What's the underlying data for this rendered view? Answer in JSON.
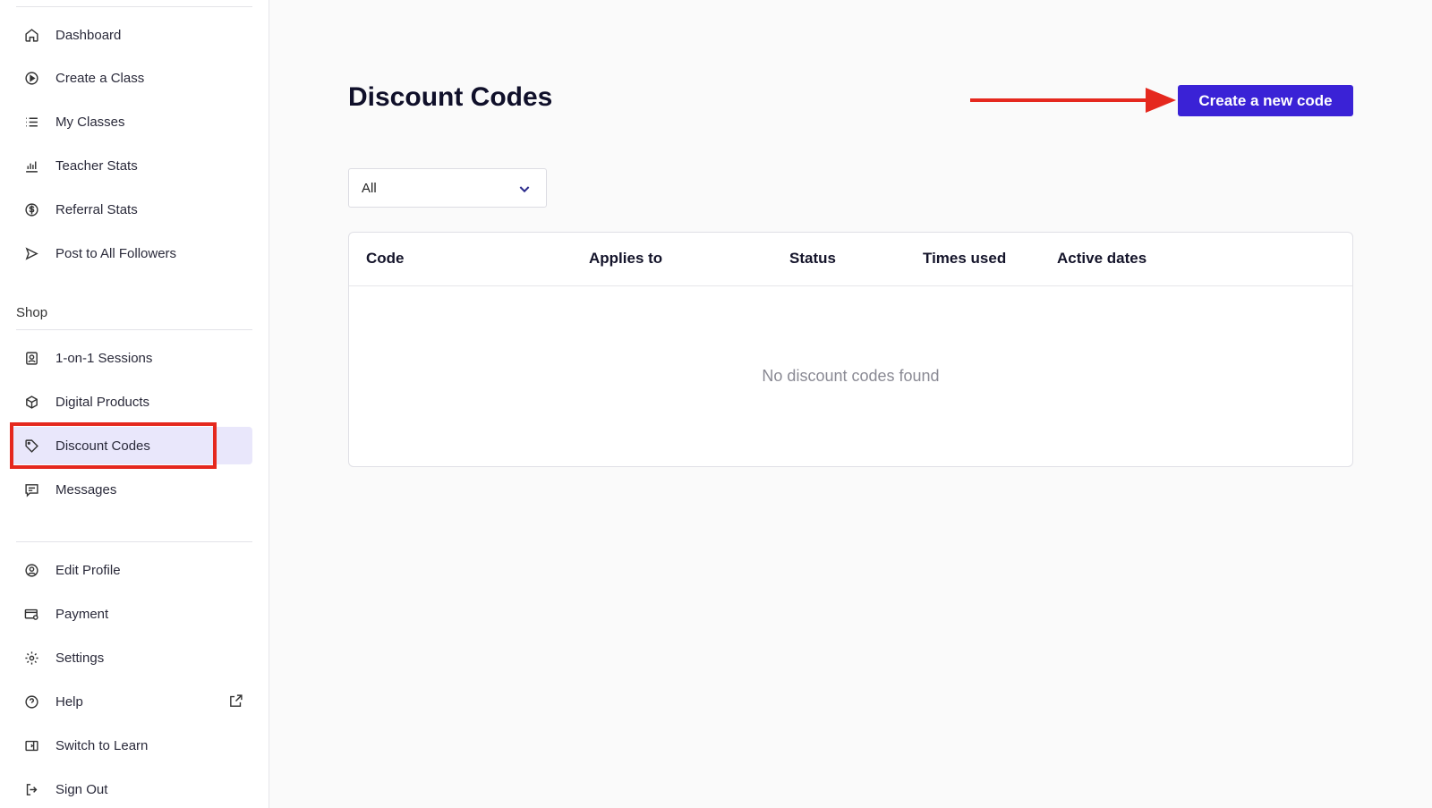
{
  "sidebar": {
    "items_top": [
      {
        "label": "Dashboard",
        "icon": "home-icon"
      },
      {
        "label": "Create a Class",
        "icon": "play-circle-icon"
      },
      {
        "label": "My Classes",
        "icon": "list-icon"
      },
      {
        "label": "Teacher Stats",
        "icon": "bar-chart-icon"
      },
      {
        "label": "Referral Stats",
        "icon": "dollar-circle-icon"
      },
      {
        "label": "Post to All Followers",
        "icon": "send-icon"
      }
    ],
    "shop_label": "Shop",
    "items_shop": [
      {
        "label": "1-on-1 Sessions",
        "icon": "user-frame-icon"
      },
      {
        "label": "Digital Products",
        "icon": "cube-icon"
      },
      {
        "label": "Discount Codes",
        "icon": "tag-icon"
      },
      {
        "label": "Messages",
        "icon": "message-icon"
      }
    ],
    "items_bottom": [
      {
        "label": "Edit Profile",
        "icon": "user-circle-icon"
      },
      {
        "label": "Payment",
        "icon": "card-gear-icon"
      },
      {
        "label": "Settings",
        "icon": "gear-icon"
      },
      {
        "label": "Help",
        "icon": "question-circle-icon"
      },
      {
        "label": "Switch to Learn",
        "icon": "switch-icon"
      },
      {
        "label": "Sign Out",
        "icon": "sign-out-icon"
      }
    ]
  },
  "main": {
    "title": "Discount Codes",
    "create_button": "Create a new code",
    "filter": {
      "selected": "All"
    },
    "table": {
      "columns": [
        "Code",
        "Applies to",
        "Status",
        "Times used",
        "Active dates"
      ],
      "empty_message": "No discount codes found"
    }
  },
  "colors": {
    "accent": "#3a22d6",
    "active_bg": "#e9e7fb",
    "annotation": "#e5281e"
  }
}
